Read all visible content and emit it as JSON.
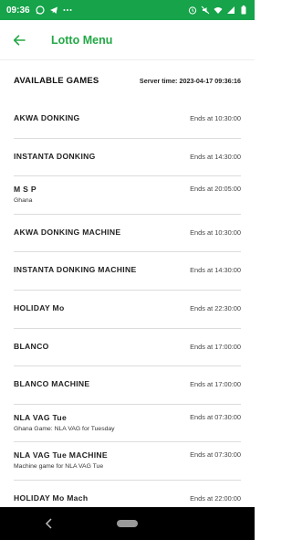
{
  "status": {
    "time": "09:36",
    "left_icons": [
      "whatsapp-icon",
      "telegram-icon",
      "more-dots-icon"
    ],
    "right_icons": [
      "alarm-icon",
      "mute-icon",
      "wifi-icon",
      "signal-icon",
      "battery-icon"
    ]
  },
  "appbar": {
    "title": "Lotto Menu",
    "back_icon": "arrow-left-icon"
  },
  "header": {
    "title": "AVAILABLE GAMES",
    "server_time": "Server time: 2023-04-17 09:36:16"
  },
  "games": [
    {
      "name": "AKWA DONKING",
      "ends": "Ends at 10:30:00",
      "sub": ""
    },
    {
      "name": "INSTANTA DONKING",
      "ends": "Ends at 14:30:00",
      "sub": ""
    },
    {
      "name": "M S P",
      "ends": "Ends at 20:05:00",
      "sub": "Ghana"
    },
    {
      "name": "AKWA DONKING MACHINE",
      "ends": "Ends at 10:30:00",
      "sub": ""
    },
    {
      "name": "INSTANTA DONKING MACHINE",
      "ends": "Ends at 14:30:00",
      "sub": ""
    },
    {
      "name": "HOLIDAY Mo",
      "ends": "Ends at 22:30:00",
      "sub": ""
    },
    {
      "name": "BLANCO",
      "ends": "Ends at 17:00:00",
      "sub": ""
    },
    {
      "name": "BLANCO MACHINE",
      "ends": "Ends at 17:00:00",
      "sub": ""
    },
    {
      "name": "NLA VAG Tue",
      "ends": "Ends at 07:30:00",
      "sub": "Ghana Game: NLA VAG for Tuesday"
    },
    {
      "name": "NLA VAG Tue MACHINE",
      "ends": "Ends at 07:30:00",
      "sub": "Machine game for NLA VAG Tue"
    },
    {
      "name": "HOLIDAY Mo Mach",
      "ends": "Ends at 22:00:00",
      "sub": ""
    }
  ],
  "colors": {
    "status_bar": "#16a34a",
    "accent": "#22a845",
    "divider": "#dcdcdc",
    "nav_bar": "#000000"
  }
}
